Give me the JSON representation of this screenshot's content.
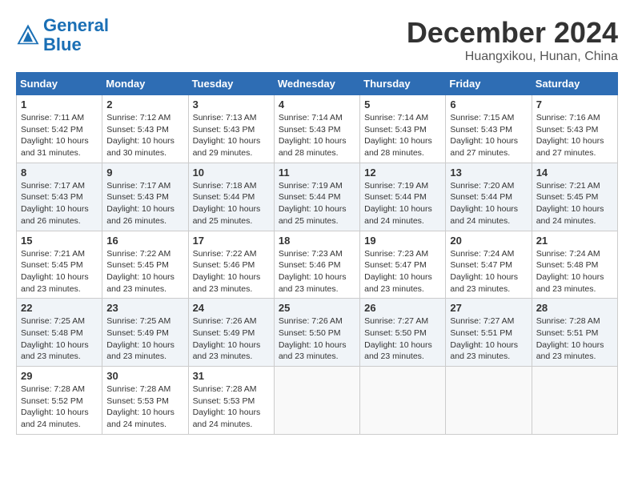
{
  "header": {
    "logo_line1": "General",
    "logo_line2": "Blue",
    "month": "December 2024",
    "location": "Huangxikou, Hunan, China"
  },
  "days_of_week": [
    "Sunday",
    "Monday",
    "Tuesday",
    "Wednesday",
    "Thursday",
    "Friday",
    "Saturday"
  ],
  "weeks": [
    [
      {
        "day": "1",
        "sunrise": "7:11 AM",
        "sunset": "5:42 PM",
        "daylight": "10 hours and 31 minutes."
      },
      {
        "day": "2",
        "sunrise": "7:12 AM",
        "sunset": "5:43 PM",
        "daylight": "10 hours and 30 minutes."
      },
      {
        "day": "3",
        "sunrise": "7:13 AM",
        "sunset": "5:43 PM",
        "daylight": "10 hours and 29 minutes."
      },
      {
        "day": "4",
        "sunrise": "7:14 AM",
        "sunset": "5:43 PM",
        "daylight": "10 hours and 28 minutes."
      },
      {
        "day": "5",
        "sunrise": "7:14 AM",
        "sunset": "5:43 PM",
        "daylight": "10 hours and 28 minutes."
      },
      {
        "day": "6",
        "sunrise": "7:15 AM",
        "sunset": "5:43 PM",
        "daylight": "10 hours and 27 minutes."
      },
      {
        "day": "7",
        "sunrise": "7:16 AM",
        "sunset": "5:43 PM",
        "daylight": "10 hours and 27 minutes."
      }
    ],
    [
      {
        "day": "8",
        "sunrise": "7:17 AM",
        "sunset": "5:43 PM",
        "daylight": "10 hours and 26 minutes."
      },
      {
        "day": "9",
        "sunrise": "7:17 AM",
        "sunset": "5:43 PM",
        "daylight": "10 hours and 26 minutes."
      },
      {
        "day": "10",
        "sunrise": "7:18 AM",
        "sunset": "5:44 PM",
        "daylight": "10 hours and 25 minutes."
      },
      {
        "day": "11",
        "sunrise": "7:19 AM",
        "sunset": "5:44 PM",
        "daylight": "10 hours and 25 minutes."
      },
      {
        "day": "12",
        "sunrise": "7:19 AM",
        "sunset": "5:44 PM",
        "daylight": "10 hours and 24 minutes."
      },
      {
        "day": "13",
        "sunrise": "7:20 AM",
        "sunset": "5:44 PM",
        "daylight": "10 hours and 24 minutes."
      },
      {
        "day": "14",
        "sunrise": "7:21 AM",
        "sunset": "5:45 PM",
        "daylight": "10 hours and 24 minutes."
      }
    ],
    [
      {
        "day": "15",
        "sunrise": "7:21 AM",
        "sunset": "5:45 PM",
        "daylight": "10 hours and 23 minutes."
      },
      {
        "day": "16",
        "sunrise": "7:22 AM",
        "sunset": "5:45 PM",
        "daylight": "10 hours and 23 minutes."
      },
      {
        "day": "17",
        "sunrise": "7:22 AM",
        "sunset": "5:46 PM",
        "daylight": "10 hours and 23 minutes."
      },
      {
        "day": "18",
        "sunrise": "7:23 AM",
        "sunset": "5:46 PM",
        "daylight": "10 hours and 23 minutes."
      },
      {
        "day": "19",
        "sunrise": "7:23 AM",
        "sunset": "5:47 PM",
        "daylight": "10 hours and 23 minutes."
      },
      {
        "day": "20",
        "sunrise": "7:24 AM",
        "sunset": "5:47 PM",
        "daylight": "10 hours and 23 minutes."
      },
      {
        "day": "21",
        "sunrise": "7:24 AM",
        "sunset": "5:48 PM",
        "daylight": "10 hours and 23 minutes."
      }
    ],
    [
      {
        "day": "22",
        "sunrise": "7:25 AM",
        "sunset": "5:48 PM",
        "daylight": "10 hours and 23 minutes."
      },
      {
        "day": "23",
        "sunrise": "7:25 AM",
        "sunset": "5:49 PM",
        "daylight": "10 hours and 23 minutes."
      },
      {
        "day": "24",
        "sunrise": "7:26 AM",
        "sunset": "5:49 PM",
        "daylight": "10 hours and 23 minutes."
      },
      {
        "day": "25",
        "sunrise": "7:26 AM",
        "sunset": "5:50 PM",
        "daylight": "10 hours and 23 minutes."
      },
      {
        "day": "26",
        "sunrise": "7:27 AM",
        "sunset": "5:50 PM",
        "daylight": "10 hours and 23 minutes."
      },
      {
        "day": "27",
        "sunrise": "7:27 AM",
        "sunset": "5:51 PM",
        "daylight": "10 hours and 23 minutes."
      },
      {
        "day": "28",
        "sunrise": "7:28 AM",
        "sunset": "5:51 PM",
        "daylight": "10 hours and 23 minutes."
      }
    ],
    [
      {
        "day": "29",
        "sunrise": "7:28 AM",
        "sunset": "5:52 PM",
        "daylight": "10 hours and 24 minutes."
      },
      {
        "day": "30",
        "sunrise": "7:28 AM",
        "sunset": "5:53 PM",
        "daylight": "10 hours and 24 minutes."
      },
      {
        "day": "31",
        "sunrise": "7:28 AM",
        "sunset": "5:53 PM",
        "daylight": "10 hours and 24 minutes."
      },
      null,
      null,
      null,
      null
    ]
  ]
}
